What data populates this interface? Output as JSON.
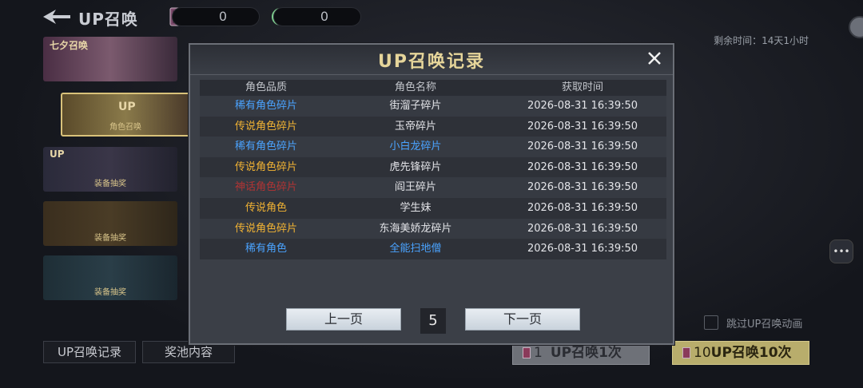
{
  "header": {
    "title": "UP召唤",
    "resource1_value": "0",
    "resource2_value": "0",
    "remaining_time": "剩余时间：14天1小时"
  },
  "banners": [
    {
      "title": "七夕召唤",
      "label": ""
    },
    {
      "title": "UP",
      "label": "角色召唤"
    },
    {
      "title": "UP",
      "label": "装备抽奖"
    },
    {
      "title": "",
      "label": "装备抽奖"
    },
    {
      "title": "",
      "label": "装备抽奖"
    }
  ],
  "modal": {
    "title": "UP召唤记录",
    "columns": [
      "角色品质",
      "角色名称",
      "获取时间"
    ],
    "rows": [
      {
        "quality": "稀有角色碎片",
        "name": "街溜子碎片",
        "time": "2026-08-31 16:39:50",
        "quality_color": "#4aa3ff",
        "name_color": "#e3e4e8"
      },
      {
        "quality": "传说角色碎片",
        "name": "玉帝碎片",
        "time": "2026-08-31 16:39:50",
        "quality_color": "#f2b333",
        "name_color": "#e3e4e8"
      },
      {
        "quality": "稀有角色碎片",
        "name": "小白龙碎片",
        "time": "2026-08-31 16:39:50",
        "quality_color": "#4aa3ff",
        "name_color": "#4aa3ff"
      },
      {
        "quality": "传说角色碎片",
        "name": "虎先锋碎片",
        "time": "2026-08-31 16:39:50",
        "quality_color": "#f2b333",
        "name_color": "#e3e4e8"
      },
      {
        "quality": "神话角色碎片",
        "name": "阎王碎片",
        "time": "2026-08-31 16:39:50",
        "quality_color": "#b03434",
        "name_color": "#e3e4e8"
      },
      {
        "quality": "传说角色",
        "name": "学生妹",
        "time": "2026-08-31 16:39:50",
        "quality_color": "#f2b333",
        "name_color": "#e3e4e8"
      },
      {
        "quality": "传说角色碎片",
        "name": "东海美娇龙碎片",
        "time": "2026-08-31 16:39:50",
        "quality_color": "#f2b333",
        "name_color": "#e3e4e8"
      },
      {
        "quality": "稀有角色",
        "name": "全能扫地僧",
        "time": "2026-08-31 16:39:50",
        "quality_color": "#4aa3ff",
        "name_color": "#4aa3ff"
      }
    ],
    "prev_label": "上一页",
    "next_label": "下一页",
    "page": "5"
  },
  "bottom": {
    "tab_history": "UP召唤记录",
    "tab_pool": "奖池内容",
    "skip_label": "跳过UP召唤动画",
    "summon1_count": "1",
    "summon1_label": "UP召唤1次",
    "summon10_count": "10",
    "summon10_label": "UP召唤10次"
  }
}
